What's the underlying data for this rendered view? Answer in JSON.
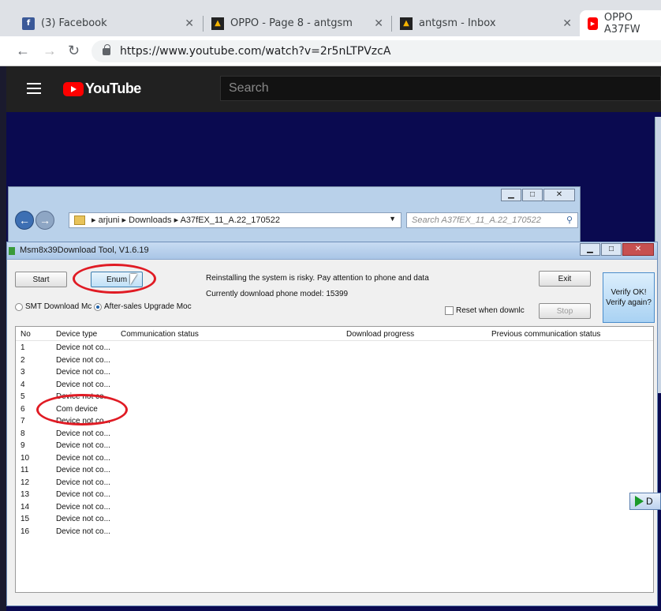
{
  "browser": {
    "tabs": [
      {
        "title": "(3) Facebook",
        "icon": "facebook-icon"
      },
      {
        "title": "OPPO - Page 8 - antgsm",
        "icon": "antgsm-icon"
      },
      {
        "title": "antgsm - Inbox",
        "icon": "antgsm-icon"
      },
      {
        "title": "OPPO A37FW",
        "icon": "youtube-icon"
      }
    ],
    "url": "https://www.youtube.com/watch?v=2r5nLTPVzcA"
  },
  "youtube": {
    "logo_text": "YouTube",
    "search_placeholder": "Search"
  },
  "explorer": {
    "breadcrumb": [
      "arjuni",
      "Downloads",
      "A37fEX_11_A.22_170522"
    ],
    "search_placeholder": "Search A37fEX_11_A.22_170522"
  },
  "tool": {
    "title": "Msm8x39Download Tool, V1.6.19",
    "start_label": "Start",
    "enum_label": "Enum",
    "exit_label": "Exit",
    "stop_label": "Stop",
    "warning": "Reinstalling the system is risky. Pay attention to phone and data",
    "model_text": "Currently download phone model: 15399",
    "mode_smt": "SMT Download Mc",
    "mode_aftersales": "After-sales Upgrade Moc",
    "reset_label": "Reset when downlc",
    "verify_line1": "Verify OK!",
    "verify_line2": "Verify again?",
    "columns": [
      "No",
      "Device type",
      "Communication status",
      "Download progress",
      "Previous communication status"
    ],
    "rows": [
      {
        "no": "1",
        "type": "Device not co..."
      },
      {
        "no": "2",
        "type": "Device not co..."
      },
      {
        "no": "3",
        "type": "Device not co..."
      },
      {
        "no": "4",
        "type": "Device not co..."
      },
      {
        "no": "5",
        "type": "Device not co..."
      },
      {
        "no": "6",
        "type": "Com device"
      },
      {
        "no": "7",
        "type": "Device not co..."
      },
      {
        "no": "8",
        "type": "Device not co..."
      },
      {
        "no": "9",
        "type": "Device not co..."
      },
      {
        "no": "10",
        "type": "Device not co..."
      },
      {
        "no": "11",
        "type": "Device not co..."
      },
      {
        "no": "12",
        "type": "Device not co..."
      },
      {
        "no": "13",
        "type": "Device not co..."
      },
      {
        "no": "14",
        "type": "Device not co..."
      },
      {
        "no": "15",
        "type": "Device not co..."
      },
      {
        "no": "16",
        "type": "Device not co..."
      }
    ]
  },
  "download_button_label": "D"
}
